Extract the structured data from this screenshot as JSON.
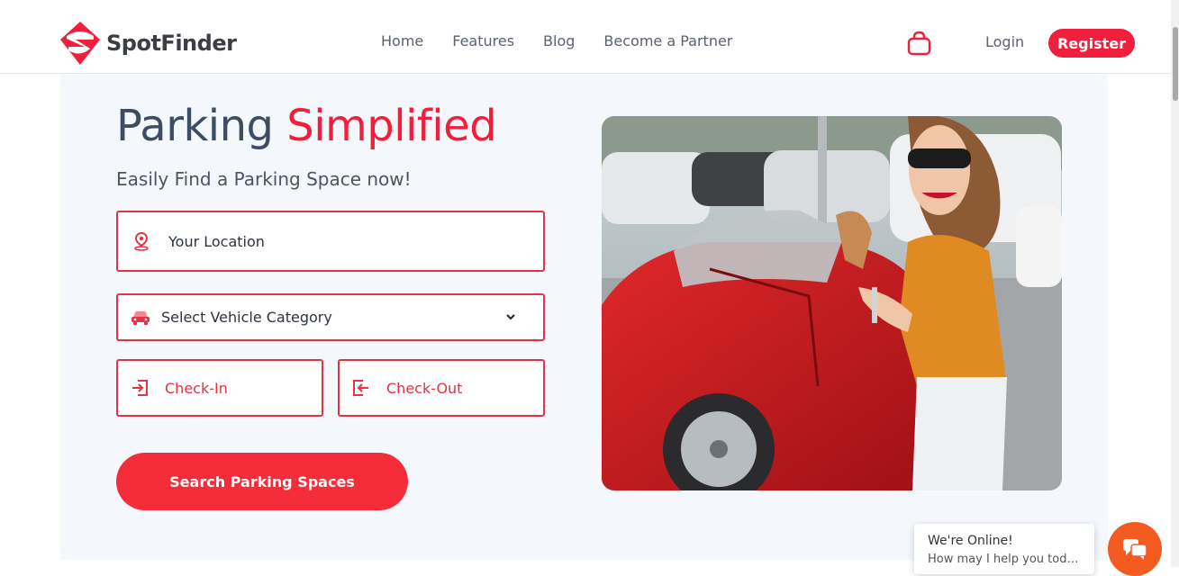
{
  "brand": {
    "name": "SpotFinder",
    "primary_color": "#f11f3b",
    "text_color": "#3b3f45"
  },
  "nav": {
    "items": [
      {
        "label": "Home"
      },
      {
        "label": "Features"
      },
      {
        "label": "Blog"
      },
      {
        "label": "Become a Partner"
      }
    ],
    "cart_icon": "shopping-bag-icon",
    "login_label": "Login",
    "register_label": "Register"
  },
  "hero": {
    "title_part1": "Parking ",
    "title_part2": "Simplified",
    "subtitle": "Easily Find a Parking Space now!",
    "location": {
      "placeholder": "Your Location",
      "icon": "map-pin-icon"
    },
    "vehicle": {
      "selected": "Select Vehicle Category",
      "icon": "car-icon"
    },
    "checkin": {
      "label": "Check-In",
      "icon": "sign-in-icon"
    },
    "checkout": {
      "label": "Check-Out",
      "icon": "sign-out-icon"
    },
    "search_button": "Search Parking Spaces",
    "photo_icon": "woman-with-red-convertible-photo"
  },
  "chat": {
    "status": "We're Online!",
    "prompt": "How may I help you today?",
    "icon": "chat-bubbles-icon",
    "button_color": "#f45b21"
  }
}
